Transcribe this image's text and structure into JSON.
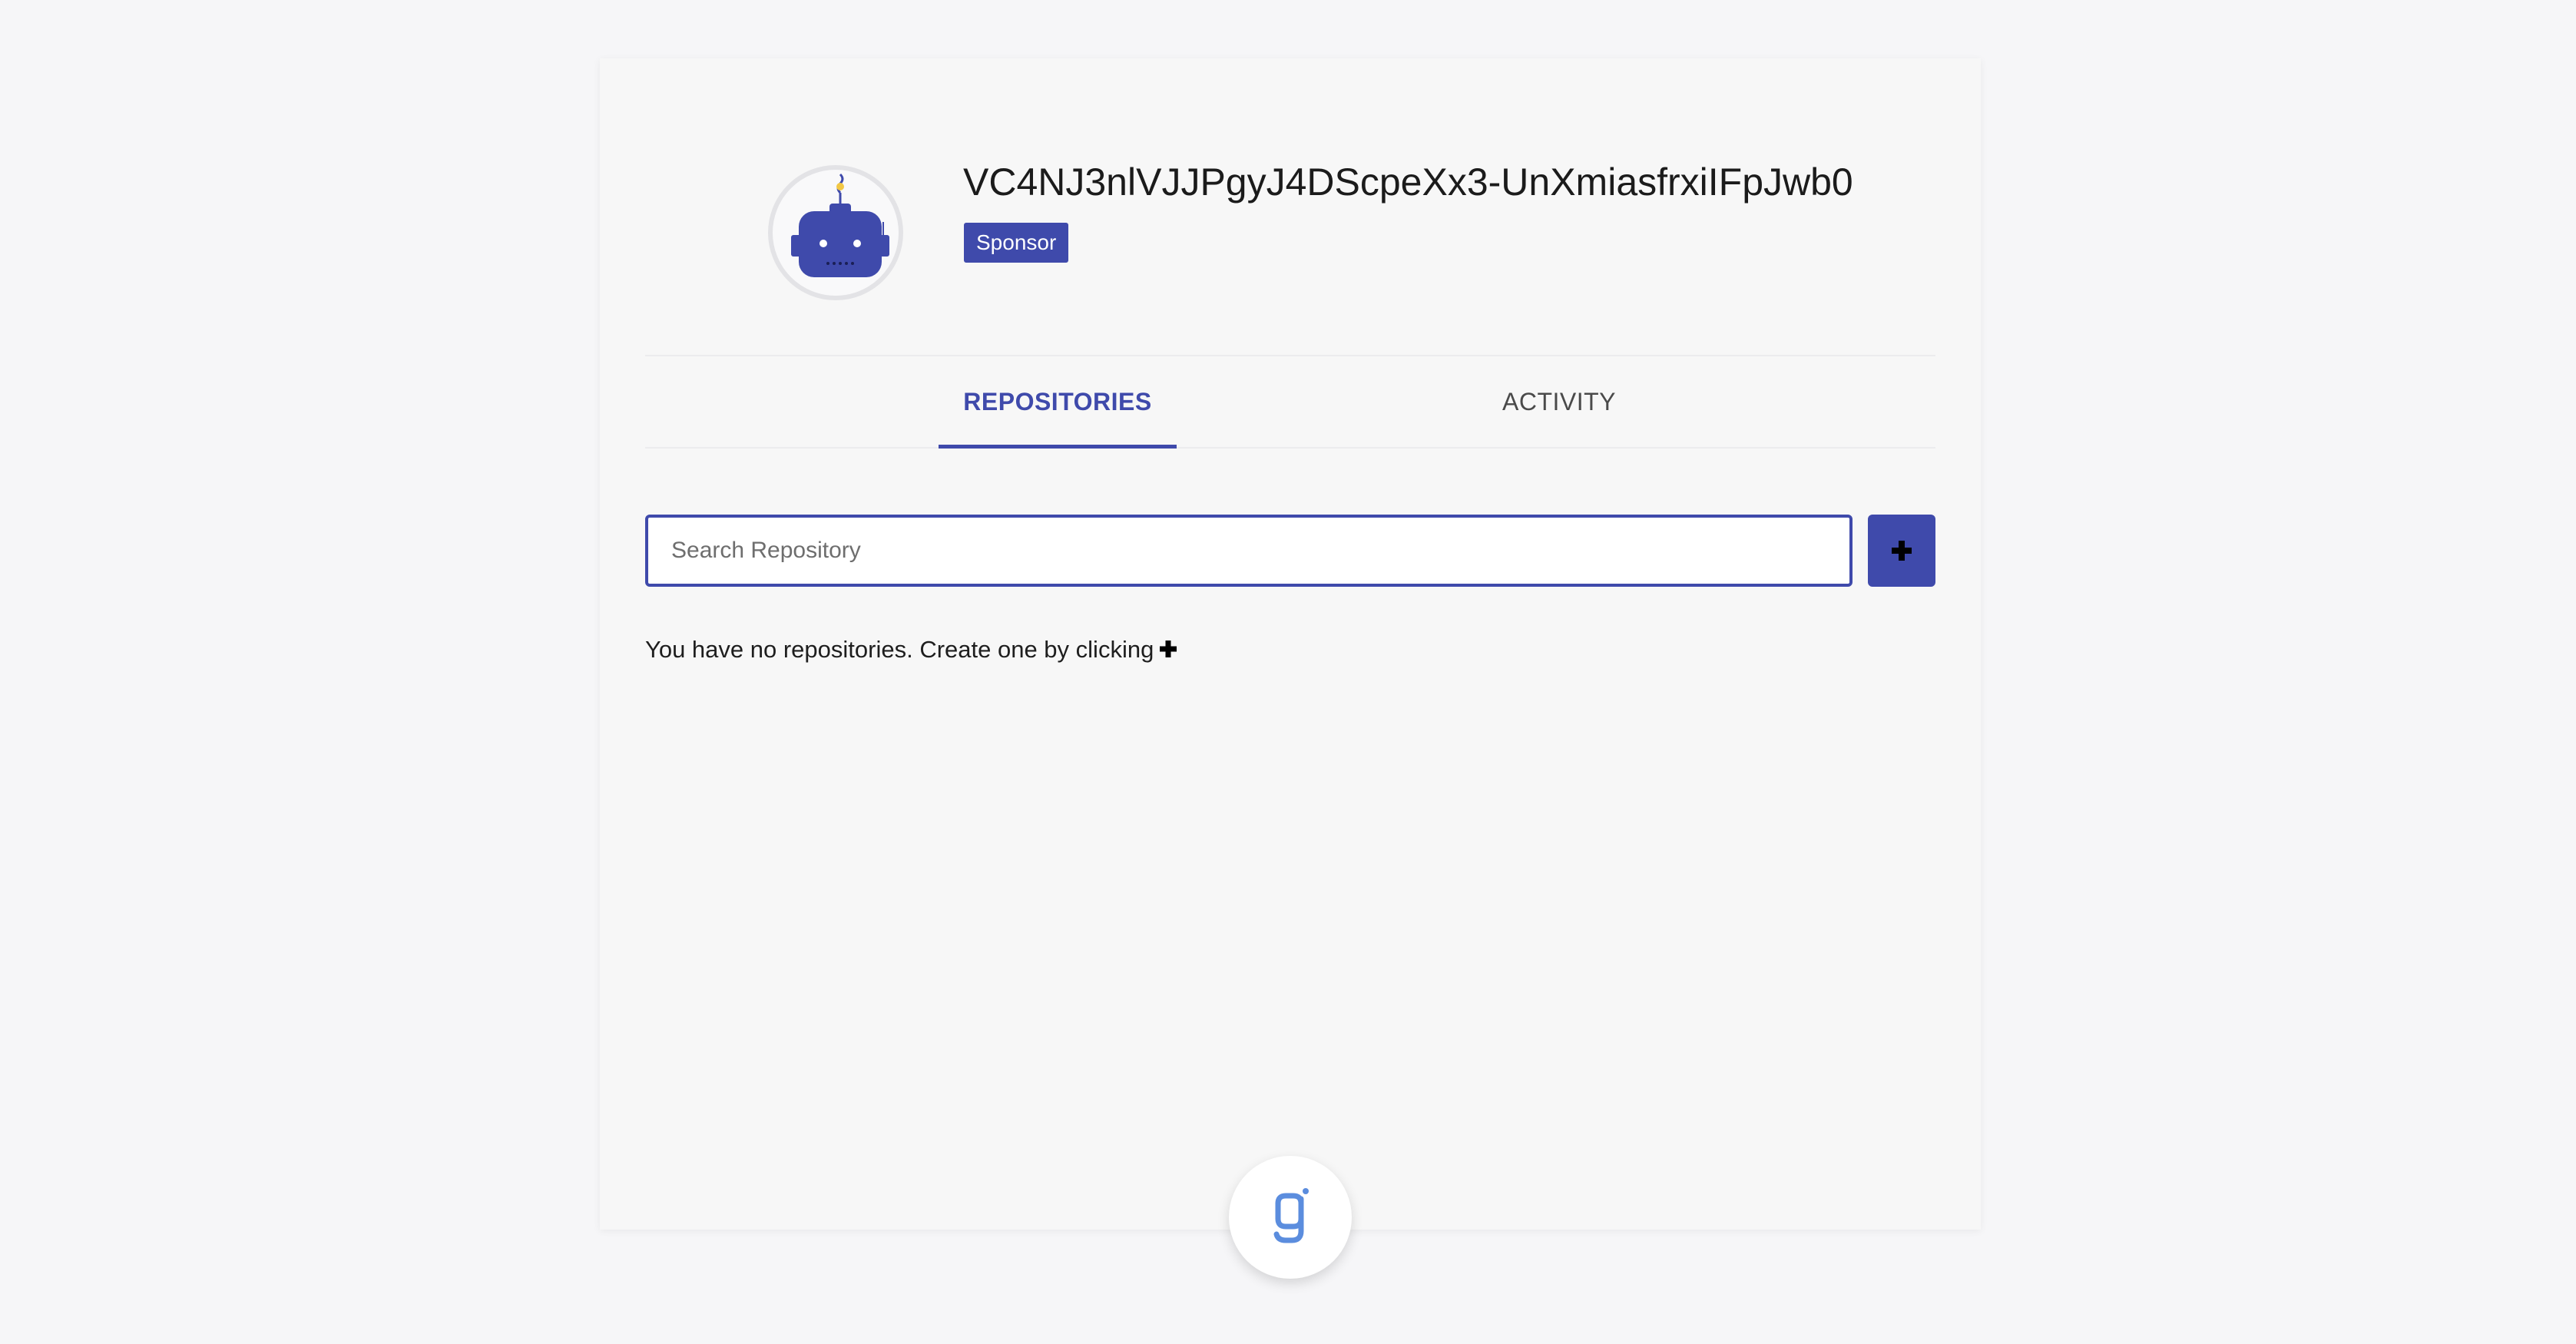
{
  "profile": {
    "username": "VC4NJ3nlVJJPgyJ4DScpeXx3-UnXmiasfrxiIFpJwb0",
    "badge": "Sponsor",
    "avatar_icon": "robot-avatar-icon"
  },
  "tabs": [
    {
      "label": "REPOSITORIES",
      "active": true
    },
    {
      "label": "ACTIVITY",
      "active": false
    }
  ],
  "search": {
    "placeholder": "Search Repository",
    "value": ""
  },
  "add_button": {
    "icon": "plus-icon"
  },
  "empty_state": {
    "text": "You have no repositories. Create one by clicking",
    "icon": "plus-icon"
  },
  "footer_logo": {
    "icon": "g-logo-icon"
  },
  "colors": {
    "accent": "#3f4aab",
    "background": "#f7f7f7",
    "logo": "#5b8dde"
  }
}
